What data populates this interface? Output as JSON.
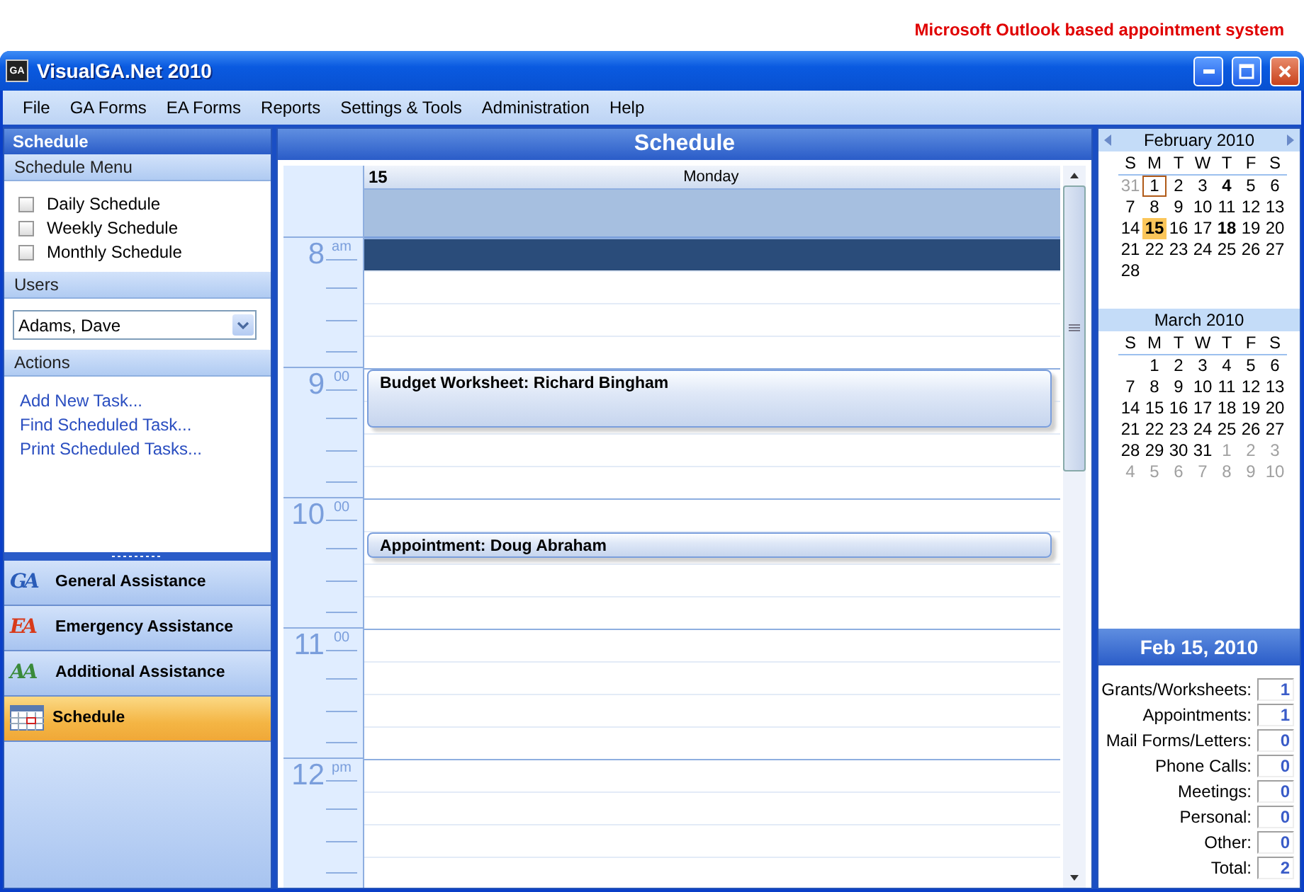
{
  "caption": "Microsoft Outlook based appointment system",
  "window": {
    "icon_text": "GA",
    "title": "VisualGA.Net 2010"
  },
  "menu": [
    "File",
    "GA Forms",
    "EA Forms",
    "Reports",
    "Settings & Tools",
    "Administration",
    "Help"
  ],
  "sidebar": {
    "title": "Schedule",
    "schedule_menu": {
      "heading": "Schedule Menu",
      "items": [
        "Daily Schedule",
        "Weekly Schedule",
        "Monthly Schedule"
      ]
    },
    "users": {
      "heading": "Users",
      "value": "Adams, Dave"
    },
    "actions": {
      "heading": "Actions",
      "links": [
        "Add New Task...",
        "Find Scheduled Task...",
        "Print Scheduled Tasks..."
      ]
    },
    "nav": [
      {
        "kind": "ga",
        "logo": "GA",
        "label": "General Assistance",
        "selected": false
      },
      {
        "kind": "ea",
        "logo": "EA",
        "label": "Emergency Assistance",
        "selected": false
      },
      {
        "kind": "aa",
        "logo": "AA",
        "label": "Additional Assistance",
        "selected": false
      },
      {
        "kind": "calendar",
        "label": "Schedule",
        "selected": true
      }
    ]
  },
  "schedule": {
    "title": "Schedule",
    "day_number": "15",
    "day_name": "Monday",
    "hours": [
      {
        "hour": "8",
        "suffix": "am",
        "slots": [
          {
            "kind": "free",
            "selected": true
          },
          {
            "kind": "free",
            "selected": false
          },
          {
            "kind": "free",
            "selected": false
          },
          {
            "kind": "free",
            "selected": false
          }
        ]
      },
      {
        "hour": "9",
        "suffix": "00",
        "slots": [
          {
            "kind": "start",
            "title": "Budget Worksheet: Richard Bingham",
            "selected": false
          },
          {
            "kind": "continued",
            "selected": false
          },
          {
            "kind": "free",
            "selected": false
          },
          {
            "kind": "free",
            "selected": false
          }
        ]
      },
      {
        "hour": "10",
        "suffix": "00",
        "slots": [
          {
            "kind": "free",
            "selected": false
          },
          {
            "kind": "start",
            "title": "Appointment: Doug Abraham",
            "selected": false
          },
          {
            "kind": "free",
            "selected": false
          },
          {
            "kind": "free",
            "selected": false
          }
        ]
      },
      {
        "hour": "11",
        "suffix": "00",
        "slots": [
          {
            "kind": "free",
            "selected": false
          },
          {
            "kind": "free",
            "selected": false
          },
          {
            "kind": "free",
            "selected": false
          },
          {
            "kind": "free",
            "selected": false
          }
        ]
      },
      {
        "hour": "12",
        "suffix": "pm",
        "slots": [
          {
            "kind": "free",
            "selected": false
          },
          {
            "kind": "free",
            "selected": false
          },
          {
            "kind": "free",
            "selected": false
          },
          {
            "kind": "free",
            "selected": false
          }
        ]
      }
    ]
  },
  "calendars": [
    {
      "title": "February 2010",
      "weekdays": [
        "S",
        "M",
        "T",
        "W",
        "T",
        "F",
        "S"
      ],
      "weeks": [
        {
          "days": [
            {
              "d": "31",
              "kind": "muted"
            },
            {
              "d": "1",
              "kind": "today"
            },
            {
              "d": "2",
              "kind": "plain"
            },
            {
              "d": "3",
              "kind": "plain"
            },
            {
              "d": "4",
              "kind": "bold"
            },
            {
              "d": "5",
              "kind": "plain"
            },
            {
              "d": "6",
              "kind": "plain"
            }
          ]
        },
        {
          "days": [
            {
              "d": "7",
              "kind": "plain"
            },
            {
              "d": "8",
              "kind": "plain"
            },
            {
              "d": "9",
              "kind": "plain"
            },
            {
              "d": "10",
              "kind": "plain"
            },
            {
              "d": "11",
              "kind": "plain"
            },
            {
              "d": "12",
              "kind": "plain"
            },
            {
              "d": "13",
              "kind": "plain"
            }
          ]
        },
        {
          "days": [
            {
              "d": "14",
              "kind": "plain"
            },
            {
              "d": "15",
              "kind": "selected"
            },
            {
              "d": "16",
              "kind": "plain"
            },
            {
              "d": "17",
              "kind": "plain"
            },
            {
              "d": "18",
              "kind": "bold"
            },
            {
              "d": "19",
              "kind": "plain"
            },
            {
              "d": "20",
              "kind": "plain"
            }
          ]
        },
        {
          "days": [
            {
              "d": "21",
              "kind": "plain"
            },
            {
              "d": "22",
              "kind": "plain"
            },
            {
              "d": "23",
              "kind": "plain"
            },
            {
              "d": "24",
              "kind": "plain"
            },
            {
              "d": "25",
              "kind": "plain"
            },
            {
              "d": "26",
              "kind": "plain"
            },
            {
              "d": "27",
              "kind": "plain"
            }
          ]
        },
        {
          "days": [
            {
              "d": "28",
              "kind": "plain"
            }
          ]
        }
      ]
    },
    {
      "title": "March 2010",
      "weekdays": [
        "S",
        "M",
        "T",
        "W",
        "T",
        "F",
        "S"
      ],
      "weeks": [
        {
          "days": [
            {
              "d": "1",
              "kind": "plain"
            },
            {
              "d": "2",
              "kind": "plain"
            },
            {
              "d": "3",
              "kind": "plain"
            },
            {
              "d": "4",
              "kind": "plain"
            },
            {
              "d": "5",
              "kind": "plain"
            },
            {
              "d": "6",
              "kind": "plain"
            }
          ]
        },
        {
          "days": [
            {
              "d": "7",
              "kind": "plain"
            },
            {
              "d": "8",
              "kind": "plain"
            },
            {
              "d": "9",
              "kind": "plain"
            },
            {
              "d": "10",
              "kind": "plain"
            },
            {
              "d": "11",
              "kind": "plain"
            },
            {
              "d": "12",
              "kind": "plain"
            },
            {
              "d": "13",
              "kind": "plain"
            }
          ]
        },
        {
          "days": [
            {
              "d": "14",
              "kind": "plain"
            },
            {
              "d": "15",
              "kind": "plain"
            },
            {
              "d": "16",
              "kind": "plain"
            },
            {
              "d": "17",
              "kind": "plain"
            },
            {
              "d": "18",
              "kind": "plain"
            },
            {
              "d": "19",
              "kind": "plain"
            },
            {
              "d": "20",
              "kind": "plain"
            }
          ]
        },
        {
          "days": [
            {
              "d": "21",
              "kind": "plain"
            },
            {
              "d": "22",
              "kind": "plain"
            },
            {
              "d": "23",
              "kind": "plain"
            },
            {
              "d": "24",
              "kind": "plain"
            },
            {
              "d": "25",
              "kind": "plain"
            },
            {
              "d": "26",
              "kind": "plain"
            },
            {
              "d": "27",
              "kind": "plain"
            }
          ]
        },
        {
          "days": [
            {
              "d": "28",
              "kind": "plain"
            },
            {
              "d": "29",
              "kind": "plain"
            },
            {
              "d": "30",
              "kind": "plain"
            },
            {
              "d": "31",
              "kind": "plain"
            },
            {
              "d": "1",
              "kind": "muted"
            },
            {
              "d": "2",
              "kind": "muted"
            },
            {
              "d": "3",
              "kind": "muted"
            }
          ]
        },
        {
          "days": [
            {
              "d": "4",
              "kind": "muted"
            },
            {
              "d": "5",
              "kind": "muted"
            },
            {
              "d": "6",
              "kind": "muted"
            },
            {
              "d": "7",
              "kind": "muted"
            },
            {
              "d": "8",
              "kind": "muted"
            },
            {
              "d": "9",
              "kind": "muted"
            },
            {
              "d": "10",
              "kind": "muted"
            }
          ]
        }
      ]
    }
  ],
  "summary": {
    "date": "Feb 15, 2010",
    "rows": [
      {
        "label": "Grants/Worksheets:",
        "value": "1"
      },
      {
        "label": "Appointments:",
        "value": "1"
      },
      {
        "label": "Mail Forms/Letters:",
        "value": "0"
      },
      {
        "label": "Phone Calls:",
        "value": "0"
      },
      {
        "label": "Meetings:",
        "value": "0"
      },
      {
        "label": "Personal:",
        "value": "0"
      },
      {
        "label": "Other:",
        "value": "0"
      },
      {
        "label": "Total:",
        "value": "2"
      }
    ]
  }
}
